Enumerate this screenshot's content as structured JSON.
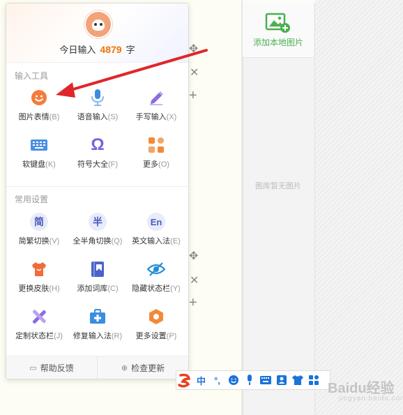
{
  "header": {
    "today_prefix": "今日输入",
    "today_count": "4879",
    "today_suffix": "字"
  },
  "tools_section": {
    "title": "输入工具",
    "items": [
      {
        "label": "图片表情",
        "key": "(B)",
        "icon": "emoji-face-icon"
      },
      {
        "label": "语音输入",
        "key": "(S)",
        "icon": "microphone-icon"
      },
      {
        "label": "手写输入",
        "key": "(X)",
        "icon": "pen-icon"
      },
      {
        "label": "软键盘",
        "key": "(K)",
        "icon": "keyboard-icon"
      },
      {
        "label": "符号大全",
        "key": "(F)",
        "icon": "omega-icon"
      },
      {
        "label": "更多",
        "key": "(O)",
        "icon": "apps-grid-icon"
      }
    ]
  },
  "settings_section": {
    "title": "常用设置",
    "items": [
      {
        "label": "简繁切换",
        "key": "(V)",
        "badge": "简"
      },
      {
        "label": "全半角切换",
        "key": "(Q)",
        "badge": "半"
      },
      {
        "label": "英文输入法",
        "key": "(E)",
        "badge": "En"
      },
      {
        "label": "更换皮肤",
        "key": "(H)",
        "icon": "shirt-icon"
      },
      {
        "label": "添加词库",
        "key": "(C)",
        "icon": "book-icon"
      },
      {
        "label": "隐藏状态栏",
        "key": "(Y)",
        "icon": "eye-hidden-icon"
      },
      {
        "label": "定制状态栏",
        "key": "(J)",
        "icon": "tools-icon"
      },
      {
        "label": "修复输入法",
        "key": "(R)",
        "icon": "medical-kit-icon"
      },
      {
        "label": "更多设置",
        "key": "(P)",
        "icon": "hex-gear-icon"
      }
    ]
  },
  "footer": {
    "help": "帮助反馈",
    "update": "检查更新"
  },
  "right_panel": {
    "upload_label": "添加本地图片",
    "empty_label": "图库暂无图片"
  },
  "statusbar": {
    "mode": "中",
    "punct": "°,"
  },
  "watermark": {
    "text": "Baidu经验",
    "sub": "jingyan.baidu.com"
  },
  "colors": {
    "accent_orange": "#f07300",
    "icon_blue": "#1a73d9",
    "upload_green": "#4caf50",
    "arrow_red": "#e0262a"
  }
}
